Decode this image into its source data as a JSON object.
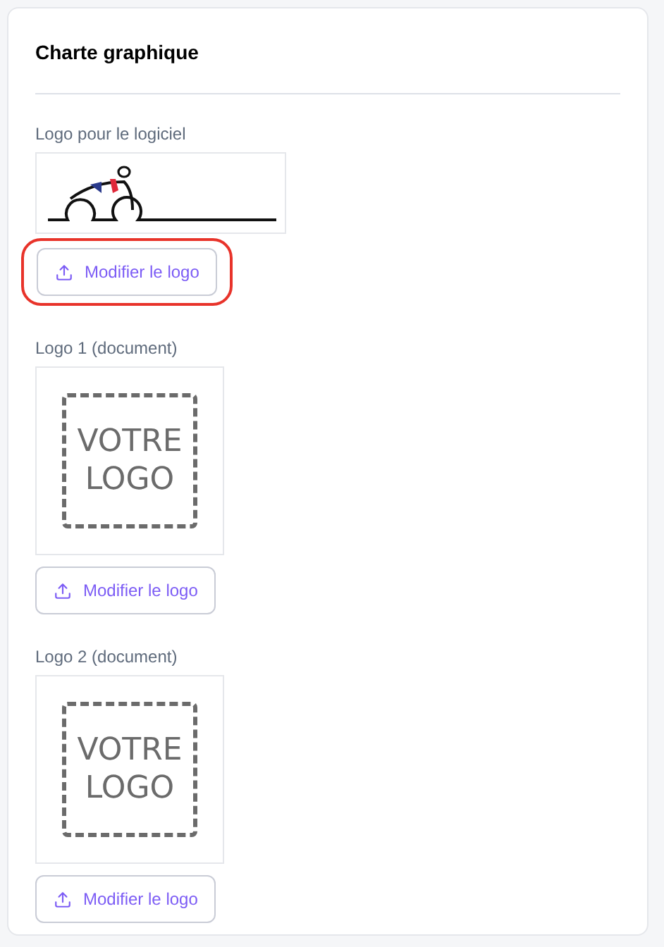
{
  "card": {
    "title": "Charte graphique"
  },
  "logos": [
    {
      "label": "Logo pour le logiciel",
      "kind": "cyclist",
      "button": "Modifier le logo",
      "highlighted": true
    },
    {
      "label": "Logo 1 (document)",
      "kind": "placeholder",
      "placeholder_lines": [
        "VOTRE",
        "LOGO"
      ],
      "button": "Modifier le logo",
      "highlighted": false
    },
    {
      "label": "Logo 2 (document)",
      "kind": "placeholder",
      "placeholder_lines": [
        "VOTRE",
        "LOGO"
      ],
      "button": "Modifier le logo",
      "highlighted": false
    }
  ]
}
